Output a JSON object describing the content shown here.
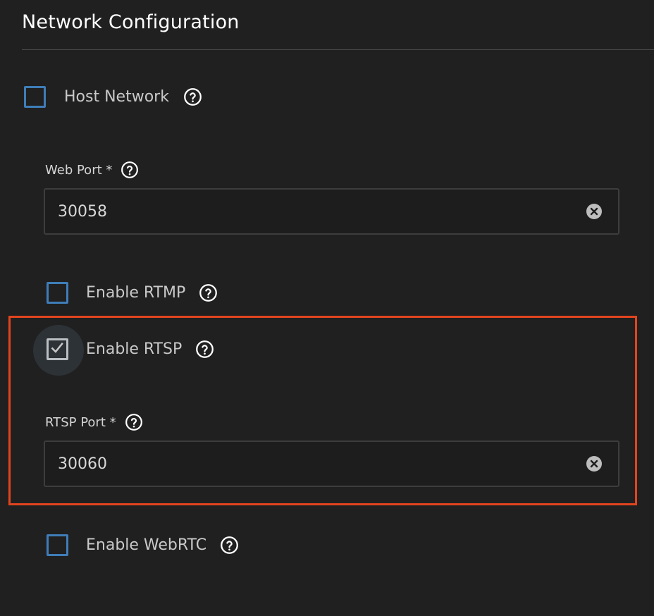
{
  "section": {
    "title": "Network Configuration"
  },
  "host_network": {
    "label": "Host Network",
    "checked": false
  },
  "web_port": {
    "label": "Web Port *",
    "value": "30058"
  },
  "enable_rtmp": {
    "label": "Enable RTMP",
    "checked": false
  },
  "enable_rtsp": {
    "label": "Enable RTSP",
    "checked": true
  },
  "rtsp_port": {
    "label": "RTSP Port *",
    "value": "30060"
  },
  "enable_webrtc": {
    "label": "Enable WebRTC",
    "checked": false
  },
  "icons": {
    "help": "help-circle-icon",
    "clear": "clear-circle-icon",
    "check": "check-mark-icon"
  },
  "colors": {
    "background": "#202020",
    "checkbox_border": "#3f7db8",
    "checked_border": "#c7c7c7",
    "highlight": "#e2441e"
  }
}
